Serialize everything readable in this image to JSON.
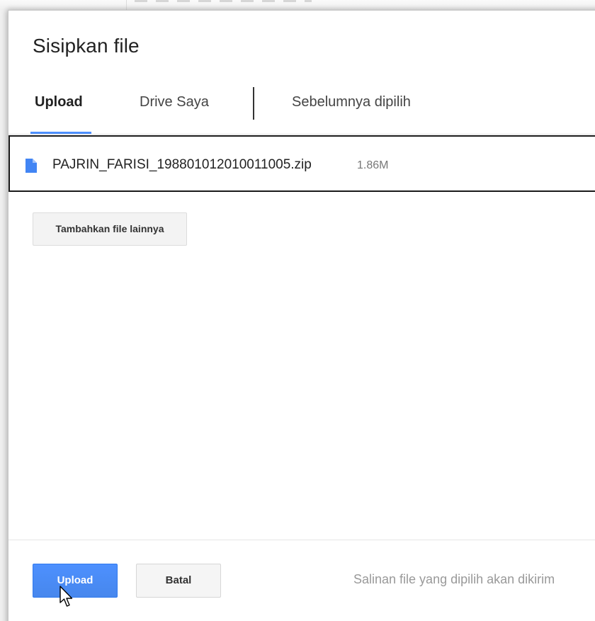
{
  "dialog": {
    "title": "Sisipkan file"
  },
  "tabs": [
    {
      "label": "Upload",
      "active": true
    },
    {
      "label": "Drive Saya",
      "active": false
    },
    {
      "label": "Sebelumnya dipilih",
      "active": false
    }
  ],
  "file": {
    "name": "PAJRIN_FARISI_198801012010011005.zip",
    "size": "1.86M",
    "icon": "file-icon"
  },
  "add_more_label": "Tambahkan file lainnya",
  "footer": {
    "upload_label": "Upload",
    "cancel_label": "Batal",
    "note": "Salinan file yang dipilih akan dikirim"
  },
  "colors": {
    "accent": "#4d90fe",
    "primary_button": "#4787ed",
    "file_icon": "#4285f4"
  }
}
